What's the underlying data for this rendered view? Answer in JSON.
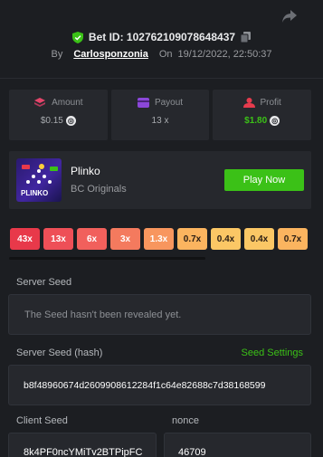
{
  "header": {
    "bet_id_label": "Bet ID: 102762109078648437",
    "by_label": "By",
    "username": "Carlosponzonia",
    "on_label": "On",
    "date": "19/12/2022, 22:50:37"
  },
  "stats": [
    {
      "label": "Amount",
      "value": "$0.15"
    },
    {
      "label": "Payout",
      "value": "13 x"
    },
    {
      "label": "Profit",
      "value": "$1.80"
    }
  ],
  "game": {
    "name": "Plinko",
    "provider": "BC Originals",
    "play_label": "Play Now",
    "thumb_text": "PLINKO"
  },
  "multipliers": [
    "43x",
    "13x",
    "6x",
    "3x",
    "1.3x",
    "0.7x",
    "0.4x",
    "0.4x",
    "0.7x"
  ],
  "multiplier_colors": [
    "#e8394a",
    "#ee4f57",
    "#f1605c",
    "#f47a5e",
    "#f8965e",
    "#fbb45f",
    "#fbc765",
    "#fbc765",
    "#fbb45f"
  ],
  "server_seed": {
    "label": "Server Seed",
    "value": "The Seed hasn't been revealed yet."
  },
  "server_seed_hash": {
    "label": "Server Seed (hash)",
    "settings_label": "Seed Settings",
    "value": "b8f48960674d2609908612284f1c64e82688c7d38168599"
  },
  "client_seed": {
    "label": "Client Seed",
    "value": "8k4PF0ncYMiTv2BTPipFC"
  },
  "nonce": {
    "label": "nonce",
    "value": "46709"
  },
  "colors": {
    "background": "#1c1e22",
    "panel": "#26282d",
    "accent_green": "#3bc117"
  },
  "icons": [
    "share-icon",
    "shield-check-icon",
    "copy-icon",
    "amount-icon",
    "payout-icon",
    "profit-icon",
    "coin-icon"
  ]
}
